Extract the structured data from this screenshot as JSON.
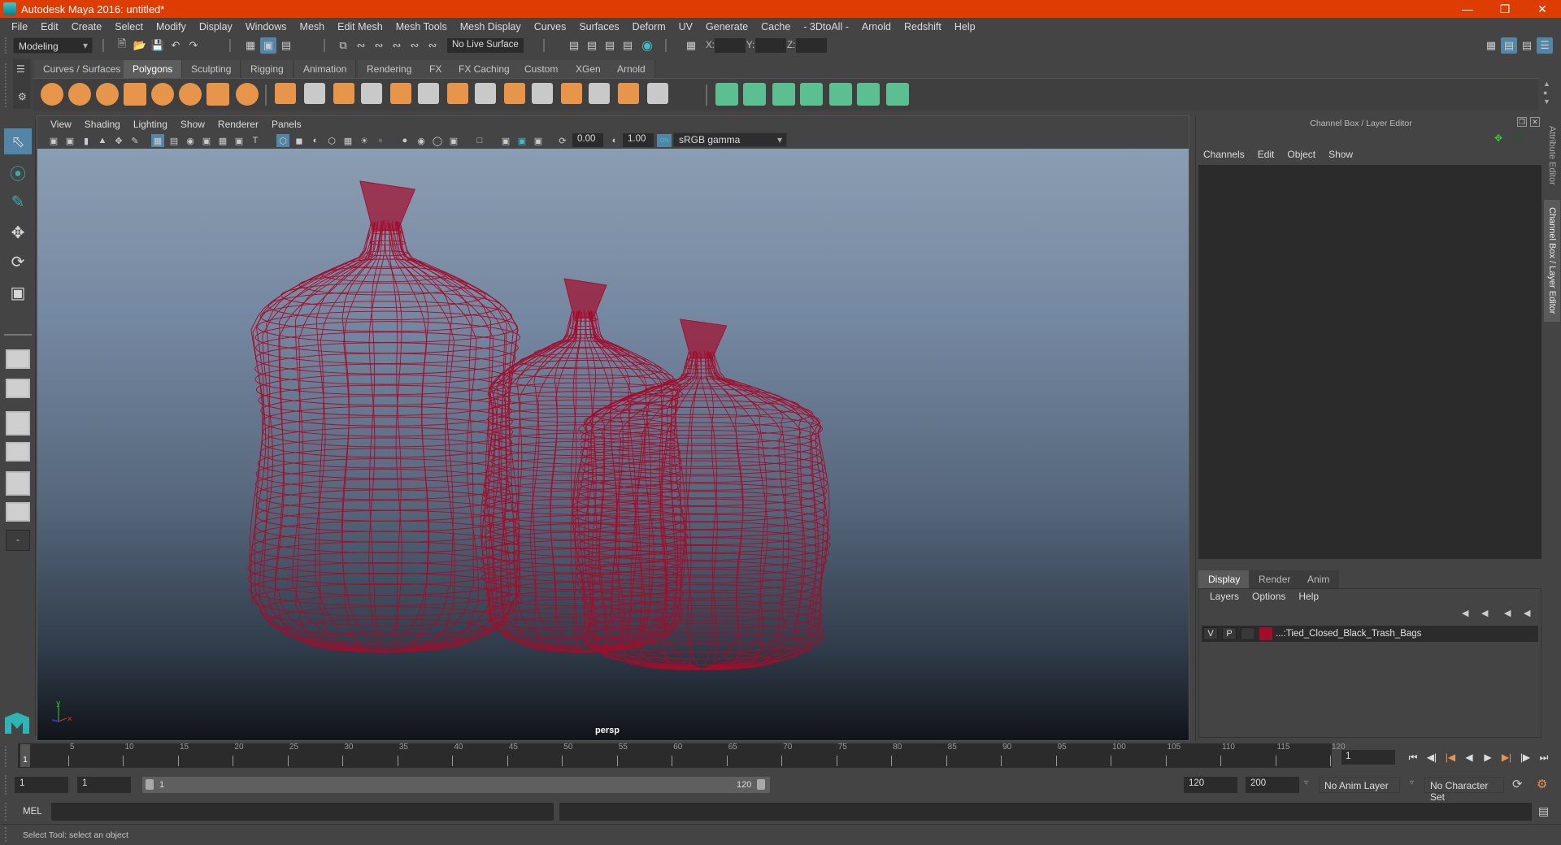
{
  "window": {
    "title": "Autodesk Maya 2016: untitled*",
    "buttons": [
      "minimize",
      "restore",
      "close"
    ]
  },
  "menubar": [
    "File",
    "Edit",
    "Create",
    "Select",
    "Modify",
    "Display",
    "Windows",
    "Mesh",
    "Edit Mesh",
    "Mesh Tools",
    "Mesh Display",
    "Curves",
    "Surfaces",
    "Deform",
    "UV",
    "Generate",
    "Cache",
    "- 3DtoAll -",
    "Arnold",
    "Redshift",
    "Help"
  ],
  "statusline": {
    "menuset": "Modeling",
    "live_surface": "No Live Surface",
    "x_label": "X:",
    "y_label": "Y:",
    "z_label": "Z:",
    "x_value": "",
    "y_value": "",
    "z_value": ""
  },
  "shelf": {
    "tabs": [
      "Curves / Surfaces",
      "Polygons",
      "Sculpting",
      "Rigging",
      "Animation",
      "Rendering",
      "FX",
      "FX Caching",
      "Custom",
      "XGen",
      "Arnold"
    ],
    "active_tab": "Polygons",
    "icons": [
      "poly-sphere",
      "poly-cube",
      "poly-cylinder",
      "poly-cone",
      "poly-plane",
      "poly-torus",
      "poly-pyramid",
      "poly-pipe",
      "combine",
      "separate",
      "mirror",
      "smooth",
      "extract",
      "bevel",
      "multi-cut",
      "extrude",
      "bridge",
      "append",
      "insert-edge-loop",
      "offset-edge-loop",
      "fill-hole",
      "target-weld",
      "planar-uv",
      "cylindrical-uv",
      "spherical-uv",
      "automatic-uv",
      "unfold-uv",
      "uv-editor",
      "layout-uv"
    ]
  },
  "viewport": {
    "menus": [
      "View",
      "Shading",
      "Lighting",
      "Show",
      "Renderer",
      "Panels"
    ],
    "exposure": "0.00",
    "gamma": "1.00",
    "color_mgmt": "ON",
    "view_transform": "sRGB gamma",
    "camera": "persp",
    "axis": {
      "x": "x",
      "y": "y",
      "z": "z"
    },
    "wire_color": "#a30d2c"
  },
  "channelbox": {
    "title": "Channel Box / Layer Editor",
    "menus": [
      "Channels",
      "Edit",
      "Object",
      "Show"
    ]
  },
  "layereditor": {
    "tabs": [
      "Display",
      "Render",
      "Anim"
    ],
    "active_tab": "Display",
    "menus": [
      "Layers",
      "Options",
      "Help"
    ],
    "layers": [
      {
        "visible": "V",
        "playback": "P",
        "ref": "",
        "color": "#a30d2c",
        "name": "...:Tied_Closed_Black_Trash_Bags"
      }
    ]
  },
  "side_tabs": [
    "Attribute Editor",
    "Channel Box / Layer Editor"
  ],
  "timeslider": {
    "ticks": [
      5,
      10,
      15,
      20,
      25,
      30,
      35,
      40,
      45,
      50,
      55,
      60,
      65,
      70,
      75,
      80,
      85,
      90,
      95,
      100,
      105,
      110,
      115,
      120
    ],
    "current_frame_marker": "1",
    "current_time": "1",
    "min": 1,
    "max": 120
  },
  "rangeslider": {
    "start_time": "1",
    "playback_start": "1",
    "range_start_label": "1",
    "range_end_label": "120",
    "playback_end": "120",
    "end_time": "200",
    "anim_layer": "No Anim Layer",
    "character_set": "No Character Set"
  },
  "commandline": {
    "language": "MEL",
    "input": "",
    "output": ""
  },
  "helpline": "Select Tool: select an object"
}
